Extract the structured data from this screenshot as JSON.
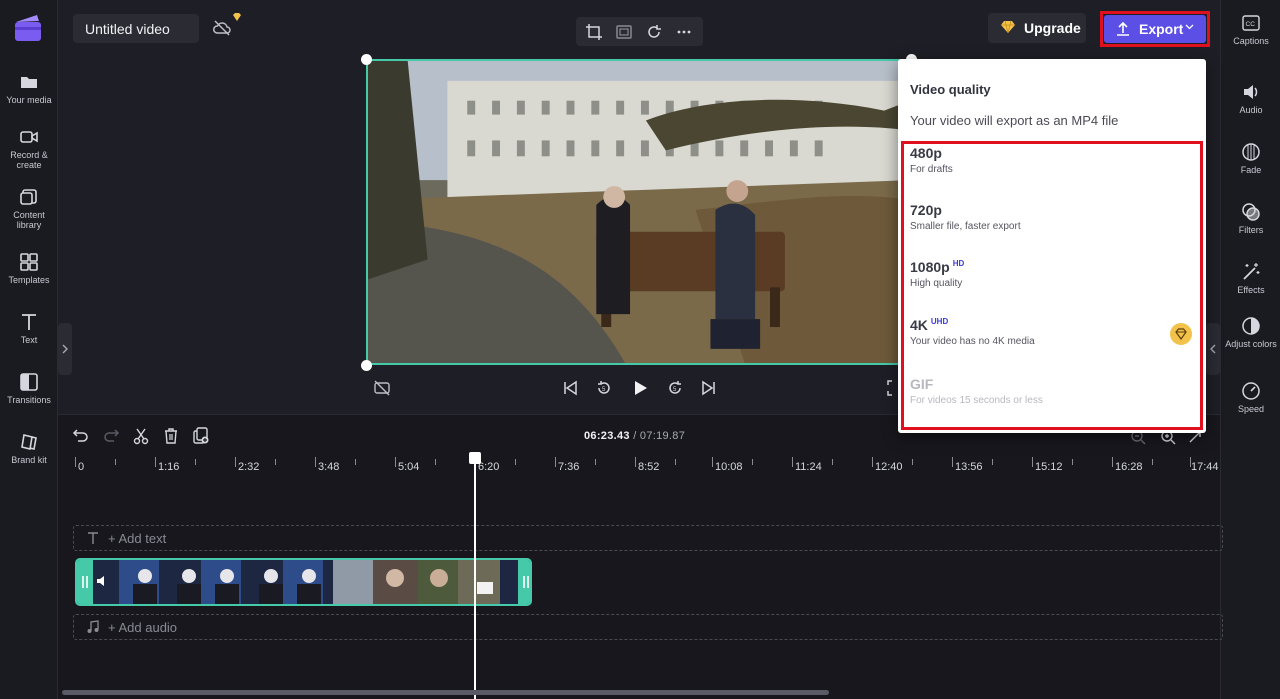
{
  "app": {
    "project_title": "Untitled video"
  },
  "left_nav": [
    {
      "label": "Your media",
      "icon": "folder-icon"
    },
    {
      "label": "Record & create",
      "icon": "camera-icon"
    },
    {
      "label": "Content library",
      "icon": "library-icon"
    },
    {
      "label": "Templates",
      "icon": "templates-icon"
    },
    {
      "label": "Text",
      "icon": "text-icon"
    },
    {
      "label": "Transitions",
      "icon": "transitions-icon"
    },
    {
      "label": "Brand kit",
      "icon": "brand-kit-icon"
    }
  ],
  "right_nav": [
    {
      "label": "Captions",
      "icon": "captions-icon"
    },
    {
      "label": "Audio",
      "icon": "audio-icon"
    },
    {
      "label": "Fade",
      "icon": "fade-icon"
    },
    {
      "label": "Filters",
      "icon": "filters-icon"
    },
    {
      "label": "Effects",
      "icon": "effects-icon"
    },
    {
      "label": "Adjust colors",
      "icon": "adjust-colors-icon"
    },
    {
      "label": "Speed",
      "icon": "speed-icon"
    }
  ],
  "toolbar": {
    "upgrade_label": "Upgrade",
    "export_label": "Export"
  },
  "export_menu": {
    "title": "Video quality",
    "subtitle": "Your video will export as an MP4 file",
    "options": [
      {
        "name": "480p",
        "badge": "",
        "description": "For drafts",
        "enabled": true
      },
      {
        "name": "720p",
        "badge": "",
        "description": "Smaller file, faster export",
        "enabled": true
      },
      {
        "name": "1080p",
        "badge": "HD",
        "description": "High quality",
        "enabled": true
      },
      {
        "name": "4K",
        "badge": "UHD",
        "description": "Your video has no 4K media",
        "enabled": true,
        "premium": true
      },
      {
        "name": "GIF",
        "badge": "",
        "description": "For videos 15 seconds or less",
        "enabled": false
      }
    ]
  },
  "timeline": {
    "current_time": "06:23.43",
    "total_time": "/ 07:19.87",
    "ruler_labels": [
      "0",
      "1:16",
      "2:32",
      "3:48",
      "5:04",
      "6:20",
      "7:36",
      "8:52",
      "10:08",
      "11:24",
      "12:40",
      "13:56",
      "15:12",
      "16:28",
      "17:44"
    ],
    "add_text_label": "+ Add text",
    "add_audio_label": "+ Add audio"
  },
  "colors": {
    "accent": "#5b4fe6",
    "selection": "#45c9a8",
    "highlight_box": "#e0101e",
    "premium": "#f3c24a"
  }
}
